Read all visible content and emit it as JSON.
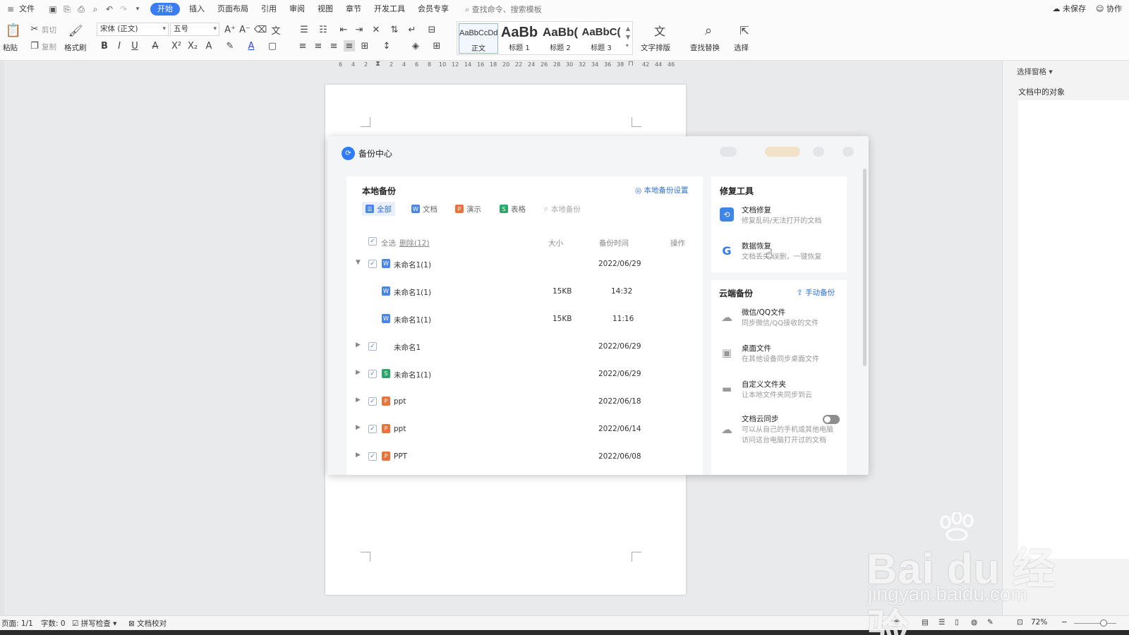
{
  "menubar": {
    "file": "文件",
    "tabs": [
      "开始",
      "插入",
      "页面布局",
      "引用",
      "审阅",
      "视图",
      "章节",
      "开发工具",
      "会员专享"
    ],
    "search": "查找命令、搜索模板",
    "unsaved": "未保存",
    "collab": "协作"
  },
  "ribbon": {
    "paste": "粘贴",
    "cut": "剪切",
    "copy": "复制",
    "format_painter": "格式刷",
    "font_name": "宋体 (正文)",
    "font_size": "五号",
    "styles": [
      {
        "sample": "AaBbCcDd",
        "name": "正文"
      },
      {
        "sample": "AaBb",
        "name": "标题 1"
      },
      {
        "sample": "AaBb(",
        "name": "标题 2"
      },
      {
        "sample": "AaBbC(",
        "name": "标题 3"
      }
    ],
    "text_layout": "文字排版",
    "find_replace": "查找替换",
    "select": "选择"
  },
  "ruler": [
    "6",
    "4",
    "2",
    "",
    "2",
    "4",
    "6",
    "8",
    "10",
    "12",
    "14",
    "16",
    "18",
    "20",
    "22",
    "24",
    "26",
    "28",
    "30",
    "32",
    "34",
    "36",
    "38",
    "40",
    "42",
    "44",
    "46"
  ],
  "dialog": {
    "title": "备份中心",
    "local": {
      "title": "本地备份",
      "settings": "本地备份设置",
      "filters": [
        {
          "label": "全部",
          "icon": "☰",
          "color": "#4a86e8"
        },
        {
          "label": "文档",
          "icon": "W",
          "color": "#4a86e8"
        },
        {
          "label": "演示",
          "icon": "P",
          "color": "#e8743b"
        },
        {
          "label": "表格",
          "icon": "S",
          "color": "#2aa86b"
        }
      ],
      "search_placeholder": "本地备份",
      "header": {
        "select_all": "全选",
        "delete": "删除(12)",
        "size": "大小",
        "time": "备份时间",
        "action": "操作"
      },
      "rows": [
        {
          "name": "未命名1(1)",
          "size": "",
          "time": "2022/06/29",
          "type": "doc",
          "level": 0,
          "expanded": true
        },
        {
          "name": "未命名1(1)",
          "size": "15KB",
          "time": "14:32",
          "type": "doc",
          "level": 1
        },
        {
          "name": "未命名1(1)",
          "size": "15KB",
          "time": "11:16",
          "type": "doc",
          "level": 1
        },
        {
          "name": "未命名1",
          "size": "",
          "time": "2022/06/29",
          "type": "none",
          "level": 0
        },
        {
          "name": "未命名1(1)",
          "size": "",
          "time": "2022/06/29",
          "type": "sheet",
          "level": 0
        },
        {
          "name": "ppt",
          "size": "",
          "time": "2022/06/18",
          "type": "ppt",
          "level": 0
        },
        {
          "name": "ppt",
          "size": "",
          "time": "2022/06/14",
          "type": "ppt",
          "level": 0
        },
        {
          "name": "PPT",
          "size": "",
          "time": "2022/06/08",
          "type": "ppt",
          "level": 0
        }
      ]
    },
    "repair": {
      "title": "修复工具",
      "items": [
        {
          "title": "文档修复",
          "desc": "修复乱码/无法打开的文档"
        },
        {
          "title": "数据恢复",
          "desc": "文档丢失/误删，一键恢复"
        }
      ]
    },
    "cloud": {
      "title": "云端备份",
      "manual": "手动备份",
      "items": [
        {
          "title": "微信/QQ文件",
          "desc": "同步微信/QQ接收的文件"
        },
        {
          "title": "桌面文件",
          "desc": "在其他设备同步桌面文件"
        },
        {
          "title": "自定义文件夹",
          "desc": "让本地文件夹同步到云"
        },
        {
          "title": "文档云同步",
          "desc1": "可以从自己的手机或其他电脑",
          "desc2": "访问这台电脑打开过的文档"
        }
      ]
    }
  },
  "sidepane": {
    "header": "选择窗格",
    "subtitle": "文档中的对象"
  },
  "statusbar": {
    "page": "页面: 1/1",
    "words": "字数: 0",
    "spell": "拼写检查",
    "proof": "文档校对",
    "zoom": "72%"
  },
  "watermark": {
    "brand": "Bai du 经验",
    "url": "jingyan.baidu.com"
  },
  "colors": {
    "accent": "#3b7cf5",
    "doc_blue": "#4a86e8",
    "ppt_orange": "#e8743b",
    "sheet_green": "#2aa86b"
  }
}
